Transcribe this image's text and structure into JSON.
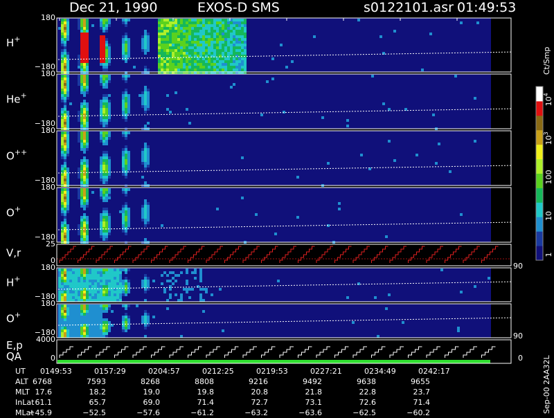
{
  "header": {
    "date": "Dec 21, 1990",
    "instrument": "EXOS-D SMS",
    "filename": "s0122101.asr",
    "time": "01:49:53"
  },
  "colorbar": {
    "units": "Ct/Smp",
    "ticks": [
      {
        "label": "1",
        "value": 1
      },
      {
        "label": "10",
        "value": 10
      },
      {
        "label": "100",
        "value": 100
      },
      {
        "label": "10",
        "sup": "3",
        "value": 1000
      },
      {
        "label": "10",
        "sup": "4",
        "value": 10000
      }
    ],
    "colors": [
      "#10107a",
      "#1a3aa0",
      "#1f8fd0",
      "#20c8c8",
      "#15b85a",
      "#5ad21e",
      "#aef02a",
      "#f0f01a",
      "#c8a018",
      "#8a6a14",
      "#e01010",
      "#ffffff"
    ],
    "scale": "log"
  },
  "chart_data": {
    "type": "heatmap",
    "time_axis_labels": [
      "0149:53",
      "0157:29",
      "0204:57",
      "0212:25",
      "0219:53",
      "0227:21",
      "0234:49",
      "0242:17"
    ],
    "panels": [
      {
        "id": "hplus",
        "label": "H",
        "sup": "+",
        "y_top": "180",
        "y_bottom": "−180",
        "kind": "spectrogram"
      },
      {
        "id": "heplus",
        "label": "He",
        "sup": "+",
        "y_top": "180",
        "y_bottom": "−180",
        "kind": "spectrogram"
      },
      {
        "id": "oplusplus",
        "label": "O",
        "sup": "++",
        "y_top": "180",
        "y_bottom": "−180",
        "kind": "spectrogram"
      },
      {
        "id": "oplus",
        "label": "O",
        "sup": "+",
        "y_top": "180",
        "y_bottom": "−180",
        "kind": "spectrogram"
      },
      {
        "id": "vr",
        "label": "V,r",
        "y_top": "25",
        "y_bottom": "0",
        "right_label": "90",
        "kind": "line"
      },
      {
        "id": "hplus2",
        "label": "H",
        "sup": "+",
        "y_top": "180",
        "y_bottom": "−180",
        "kind": "spectrogram"
      },
      {
        "id": "oplus2",
        "label": "O",
        "sup": "+",
        "y_top": "180",
        "y_bottom": "−180",
        "kind": "spectrogram"
      },
      {
        "id": "ep",
        "label": "E,p",
        "label2": "QA",
        "y_top": "4000",
        "y_bottom": "0",
        "right_label_top": "90",
        "right_label_bottom": "0",
        "kind": "line"
      }
    ]
  },
  "table": {
    "rows": [
      {
        "label": "UT",
        "values": [
          "0149:53",
          "0157:29",
          "0204:57",
          "0212:25",
          "0219:53",
          "0227:21",
          "0234:49",
          "0242:17"
        ]
      },
      {
        "label": "ALT",
        "values": [
          "6768",
          "7593",
          "8268",
          "8808",
          "9216",
          "9492",
          "9638",
          "9655"
        ]
      },
      {
        "label": "MLT",
        "values": [
          "17.6",
          "18.2",
          "19.0",
          "19.8",
          "20.8",
          "21.8",
          "22.8",
          "23.7"
        ]
      },
      {
        "label": "InLat",
        "values": [
          "61.1",
          "65.7",
          "69.0",
          "71.4",
          "72.7",
          "73.1",
          "72.6",
          "71.4"
        ]
      },
      {
        "label": "MLat",
        "values": [
          "−45.9",
          "−52.5",
          "−57.6",
          "−61.2",
          "−63.2",
          "−63.6",
          "−62.5",
          "−60.2"
        ]
      }
    ]
  },
  "footer": {
    "vertical_stamp": "Sep-00  2AA32L"
  }
}
